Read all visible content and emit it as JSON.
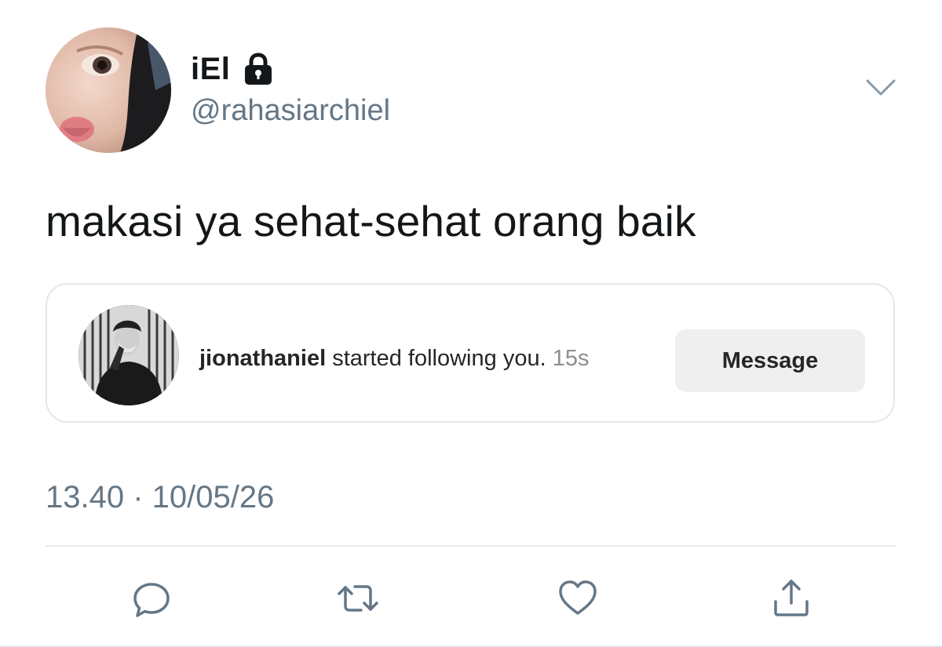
{
  "author": {
    "display_name": "iEl",
    "handle": "@rahasiarchiel",
    "protected_icon": "lock-icon"
  },
  "tweet": {
    "text": "makasi ya sehat-sehat orang baik",
    "timestamp": "13.40 · 10/05/26"
  },
  "embedded_notification": {
    "username": "jionathaniel",
    "action_text": "started following you.",
    "time_ago": "15s",
    "button_label": "Message"
  },
  "actions": [
    {
      "icon": "reply-icon"
    },
    {
      "icon": "retweet-icon"
    },
    {
      "icon": "like-icon"
    },
    {
      "icon": "share-icon"
    }
  ],
  "colors": {
    "primary_text": "#14171a",
    "secondary_text": "#657786",
    "border": "#e1e8ed",
    "button_bg": "#efefef"
  }
}
